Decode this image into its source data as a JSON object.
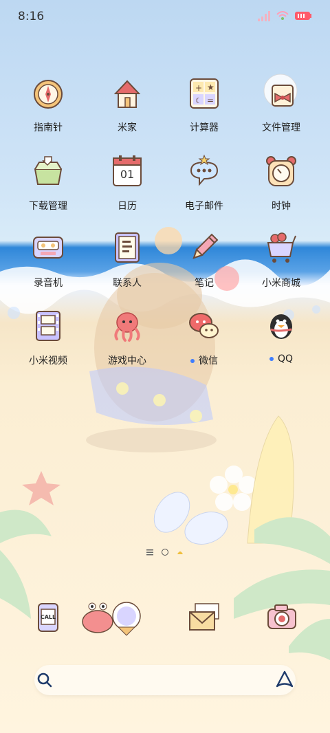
{
  "status_bar": {
    "time": "8:16"
  },
  "apps": [
    {
      "name": "指南针",
      "icon": "compass-icon"
    },
    {
      "name": "米家",
      "icon": "house-icon"
    },
    {
      "name": "计算器",
      "icon": "calculator-icon"
    },
    {
      "name": "文件管理",
      "icon": "folder-bow-icon"
    },
    {
      "name": "下载管理",
      "icon": "download-box-icon"
    },
    {
      "name": "日历",
      "icon": "calendar-icon",
      "value": "01"
    },
    {
      "name": "电子邮件",
      "icon": "speech-bubble-icon"
    },
    {
      "name": "时钟",
      "icon": "alarm-clock-icon"
    },
    {
      "name": "录音机",
      "icon": "cassette-icon"
    },
    {
      "name": "联系人",
      "icon": "notebook-icon"
    },
    {
      "name": "笔记",
      "icon": "pencil-icon"
    },
    {
      "name": "小米商城",
      "icon": "shopping-cart-icon"
    },
    {
      "name": "小米视频",
      "icon": "film-strip-icon"
    },
    {
      "name": "游戏中心",
      "icon": "octopus-icon"
    },
    {
      "name": "微信",
      "icon": "chat-bubbles-icon",
      "badge": true
    },
    {
      "name": "QQ",
      "icon": "penguin-icon",
      "badge": true
    }
  ],
  "dock": [
    {
      "name": "phone",
      "icon": "call-phone-icon",
      "text": "CALL"
    },
    {
      "name": "messages",
      "icon": "crab-icon"
    },
    {
      "name": "mail",
      "icon": "envelope-icon"
    },
    {
      "name": "camera",
      "icon": "camera-icon"
    }
  ],
  "search": {
    "placeholder": ""
  },
  "colors": {
    "badge": "#3d7dff",
    "ocean": "#2f87d9",
    "sand": "#fbeed3"
  }
}
